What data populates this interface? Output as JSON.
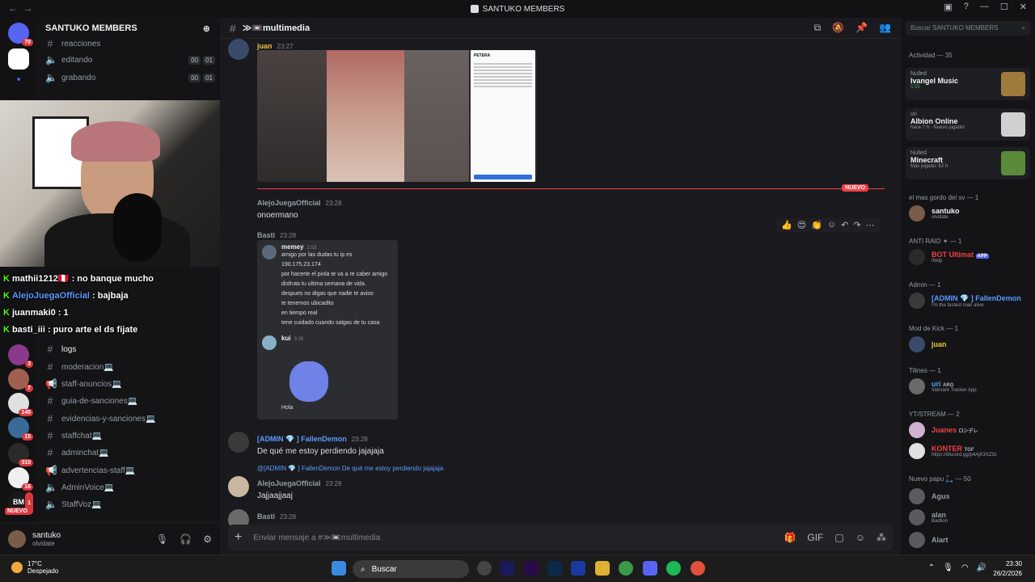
{
  "window": {
    "title": "SANTUKO MEMBERS"
  },
  "server": {
    "name": "SANTUKO MEMBERS"
  },
  "channels": [
    {
      "name": "reacciones",
      "counts": []
    },
    {
      "name": "editando",
      "counts": [
        "00",
        "01"
      ]
    },
    {
      "name": "grabando",
      "counts": [
        "00",
        "01"
      ]
    },
    {
      "name": "logs"
    },
    {
      "name": "moderacion💻"
    },
    {
      "name": "staff-anuncios💻"
    },
    {
      "name": "guia-de-sanciones💻"
    },
    {
      "name": "evidencias-y-sanciones💻"
    },
    {
      "name": "staffchat💻"
    },
    {
      "name": "adminchat💻"
    },
    {
      "name": "advertencias-staff💻"
    },
    {
      "name": "AdminVoice💻"
    },
    {
      "name": "StaffVoz💻"
    }
  ],
  "guild_badges": [
    "70",
    "3",
    "7",
    "145",
    "15",
    "310",
    "16",
    "1"
  ],
  "guild_new_label": "NUEVO",
  "stream_chat": [
    {
      "user": "mathii1212🇵🇪",
      "text": ": no banque mucho"
    },
    {
      "user": "AlejoJuegaOfficial",
      "text": ": bajbaja"
    },
    {
      "user": "juanmaki0",
      "text": ": 1"
    },
    {
      "user": "basti_iii",
      "text": ": puro arte el ds fijate"
    }
  ],
  "user_panel": {
    "name": "santuko",
    "status": "olvidate"
  },
  "channel_header": {
    "name": "≫📼multimedia"
  },
  "messages": {
    "juan": {
      "author": "juan",
      "time": "23:27"
    },
    "alejo": {
      "author": "AlejoJuegaOfficial",
      "time": "23:28",
      "text": "onoermano"
    },
    "basti": {
      "author": "Basti",
      "time": "23:28"
    },
    "fallen": {
      "author": "[ADMIN 💎 ] FallenDemon",
      "time": "23:28",
      "text": "De qué me estoy perdiendo jajajaja"
    },
    "alejo2": {
      "reply": "@[ADMIN 💎 ] FallenDemon De qué me estoy perdiendo jajajaja",
      "author": "AlejoJuegaOfficial",
      "time": "23:28",
      "text": "Jajjaajjaaj"
    },
    "basti2": {
      "author": "Basti",
      "time": "23:28"
    }
  },
  "new_badge": "NUEVO",
  "screenshot": {
    "author": "memey",
    "time": "2:53",
    "lines": [
      "amigo por las dudas tu ip es",
      "190.175.23.174",
      "por hacerte el piola te va a re caber amigo",
      "disfruta tu ultima semana de vida.",
      "despues no digas que nadie te aviso",
      "te tenemos ubicadito",
      "en tiempo real",
      "tene cuidado cuando salgas de tu casa"
    ],
    "author2": "kui",
    "time2": "3:26",
    "hola": "Hola"
  },
  "embed_doc": {
    "title": "PETERA"
  },
  "composer": {
    "placeholder": "Enviar mensaje a #≫📼multimedia"
  },
  "members_panel": {
    "search": "Buscar SANTUKO MEMBERS",
    "activity_title": "Actividad — 35",
    "activities": [
      {
        "who": "Nulled",
        "name": "Ivangel Music",
        "status": "5:55"
      },
      {
        "who": "uri",
        "name": "Albion Online",
        "status": "hace 7 h · Nuevo jugador"
      },
      {
        "who": "Nulled",
        "name": "Minecraft",
        "status": "Más jugado: 62 h"
      }
    ],
    "sections": [
      {
        "title": "el mas gordo del sv — 1"
      },
      {
        "title": "ANTI RAID ✦ — 1"
      },
      {
        "title": "Admin — 1"
      },
      {
        "title": "Mod de Kick — 1"
      },
      {
        "title": "Tilines — 1"
      },
      {
        "title": "YT/STREAM — 2"
      },
      {
        "title": "Nuevo papu 🛴 — 50"
      }
    ],
    "members": [
      {
        "name": "santuko",
        "status": "olvidate",
        "color": "#f2f3f5"
      },
      {
        "name": "BOT Ultimat",
        "status": "/help",
        "color": "#f23f43"
      },
      {
        "name": "[ADMIN 💎 ] FallenDemon",
        "status": "I'm the fastest man alive",
        "color": "#5b9bff"
      },
      {
        "name": "juan",
        "status": "",
        "color": "#f0c040"
      },
      {
        "name": "uri",
        "status": "Valorant Tracker App",
        "color": "#5b9bff"
      },
      {
        "name": "Juanes",
        "status": "",
        "color": "#f23f43"
      },
      {
        "name": "KONTER",
        "status": "https://discord.gg/p4AjK3XZ3z",
        "color": "#f23f43"
      },
      {
        "name": "Agus",
        "status": "",
        "color": "#949ba4"
      },
      {
        "name": "alan",
        "status": "Badlion",
        "color": "#949ba4"
      },
      {
        "name": "Alart",
        "status": "",
        "color": "#949ba4"
      }
    ],
    "tags": {
      "app": "APP",
      "arg": "ARG",
      "tgf": "TGF",
      "jp": "ロシデレ"
    }
  },
  "taskbar": {
    "temp": "17°C",
    "weather": "Despejado",
    "search": "Buscar",
    "time": "23:30",
    "date": "26/2/2026"
  }
}
